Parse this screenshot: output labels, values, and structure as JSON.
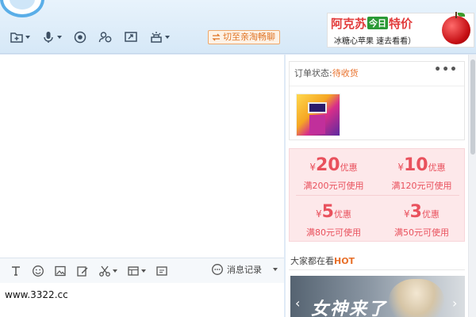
{
  "header": {
    "switch_label": "切至亲淘畅聊",
    "toolbar_icons": [
      "folder-icon",
      "microphone-icon",
      "camera-icon",
      "contacts-icon",
      "share-screen-icon",
      "remote-assist-icon"
    ]
  },
  "ad": {
    "line1_a": "阿克苏",
    "line1_tag": "今日",
    "line1_b": "特价",
    "line2": "冰糖心苹果  速去看看）"
  },
  "input": {
    "toolbar_icons": [
      "font-icon",
      "emoji-icon",
      "image-icon",
      "edit-icon",
      "scissors-icon",
      "screenshot-icon",
      "window-icon"
    ],
    "history_label": "消息记录",
    "text": "www.3322.cc"
  },
  "order": {
    "label": "订单状态:",
    "status": "待收货",
    "more": "•••"
  },
  "coupons": [
    {
      "yen": "¥",
      "amount": "20",
      "unit": "优惠",
      "condition": "满200元可使用"
    },
    {
      "yen": "¥",
      "amount": "10",
      "unit": "优惠",
      "condition": "满120元可使用"
    },
    {
      "yen": "¥",
      "amount": "5",
      "unit": "优惠",
      "condition": "满80元可使用"
    },
    {
      "yen": "¥",
      "amount": "3",
      "unit": "优惠",
      "condition": "满50元可使用"
    }
  ],
  "trending": {
    "title": "大家都在看",
    "hot": "HOT",
    "promo_text": "女神来了",
    "arrow_left": "‹",
    "arrow_right": "›"
  },
  "colors": {
    "accent_orange": "#e8702a",
    "coupon_red": "#e9515d",
    "header_blue": "#d6e8f7"
  }
}
